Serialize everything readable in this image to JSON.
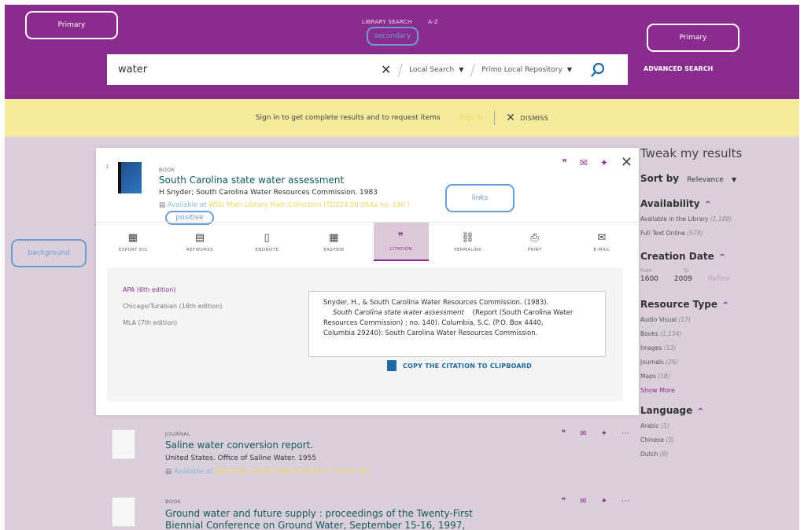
{
  "annotations": {
    "primary_left": "Primary",
    "secondary": "secondary",
    "primary_right": "Primary",
    "links": "links",
    "positive": "positive",
    "background": "background"
  },
  "header": {
    "links": [
      "LIBRARY SEARCH",
      "A-Z"
    ],
    "search_value": "water",
    "scope1": "Local Search",
    "scope2": "Primo Local Repository",
    "advanced": "ADVANCED SEARCH"
  },
  "signbar": {
    "text": "Sign in to get complete results and to request items",
    "signin": "Sign in",
    "dismiss": "DISMISS"
  },
  "record": {
    "num": "1",
    "type": "BOOK",
    "title": "South Carolina state water assessment",
    "author": "H Snyder; South Carolina Water Resources Commission. 1983",
    "avail_label": "Available at",
    "avail_location": "WSU Main Library Main Collection (TD224.S6 S64a no. 140 )"
  },
  "tabs": [
    {
      "label": "EXPORT RIS"
    },
    {
      "label": "REFWORKS"
    },
    {
      "label": "ENDNOTE"
    },
    {
      "label": "EASYBIB"
    },
    {
      "label": "CITATION"
    },
    {
      "label": "PERMALINK"
    },
    {
      "label": "PRINT"
    },
    {
      "label": "E-MAIL"
    }
  ],
  "citation": {
    "styles": [
      "APA (6th edition)",
      "Chicago/Turabian (16th edition)",
      "MLA (7th edition)"
    ],
    "line1": "Snyder, H., & South Carolina Water Resources Commission. (1983).",
    "line2_italic": "South Carolina state water assessment",
    "line2_rest": "(Report (South Carolina Water",
    "line3": "Resources Commission) ; no. 140). Columbia, S.C. (P.O. Box 4440,",
    "line4": "Columbia 29240): South Carolina Water Resources Commission.",
    "copy": "COPY THE CITATION TO CLIPBOARD"
  },
  "results": [
    {
      "type": "JOURNAL",
      "title": "Saline water conversion report.",
      "author": "United States. Office of Saline Water. 1955",
      "avail_label": "Available at",
      "avail_location": "WSU Main Library Main Collection (TD479 .A2)"
    },
    {
      "type": "BOOK",
      "title1": "Ground water and future supply : proceedings of the Twenty-First",
      "title2": "Biennial Conference on Ground Water, September 15-16, 1997,"
    }
  ],
  "sidebar": {
    "heading": "Tweak my results",
    "sort_label": "Sort by",
    "sort_value": "Relevance",
    "availability": {
      "title": "Availability",
      "items": [
        {
          "label": "Available in the Library",
          "count": "(1,189)"
        },
        {
          "label": "Full Text Online",
          "count": "(579)"
        }
      ]
    },
    "creation": {
      "title": "Creation Date",
      "from_label": "From",
      "to_label": "To",
      "from": "1600",
      "to": "2009",
      "refine": "Refine"
    },
    "resource": {
      "title": "Resource Type",
      "items": [
        {
          "label": "Audio Visual",
          "count": "(17)"
        },
        {
          "label": "Books",
          "count": "(1,134)"
        },
        {
          "label": "Images",
          "count": "(13)"
        },
        {
          "label": "Journals",
          "count": "(26)"
        },
        {
          "label": "Maps",
          "count": "(18)"
        }
      ],
      "more": "Show More"
    },
    "language": {
      "title": "Language",
      "items": [
        {
          "label": "Arabic",
          "count": "(1)"
        },
        {
          "label": "Chinese",
          "count": "(3)"
        },
        {
          "label": "Dutch",
          "count": "(8)"
        }
      ]
    }
  }
}
